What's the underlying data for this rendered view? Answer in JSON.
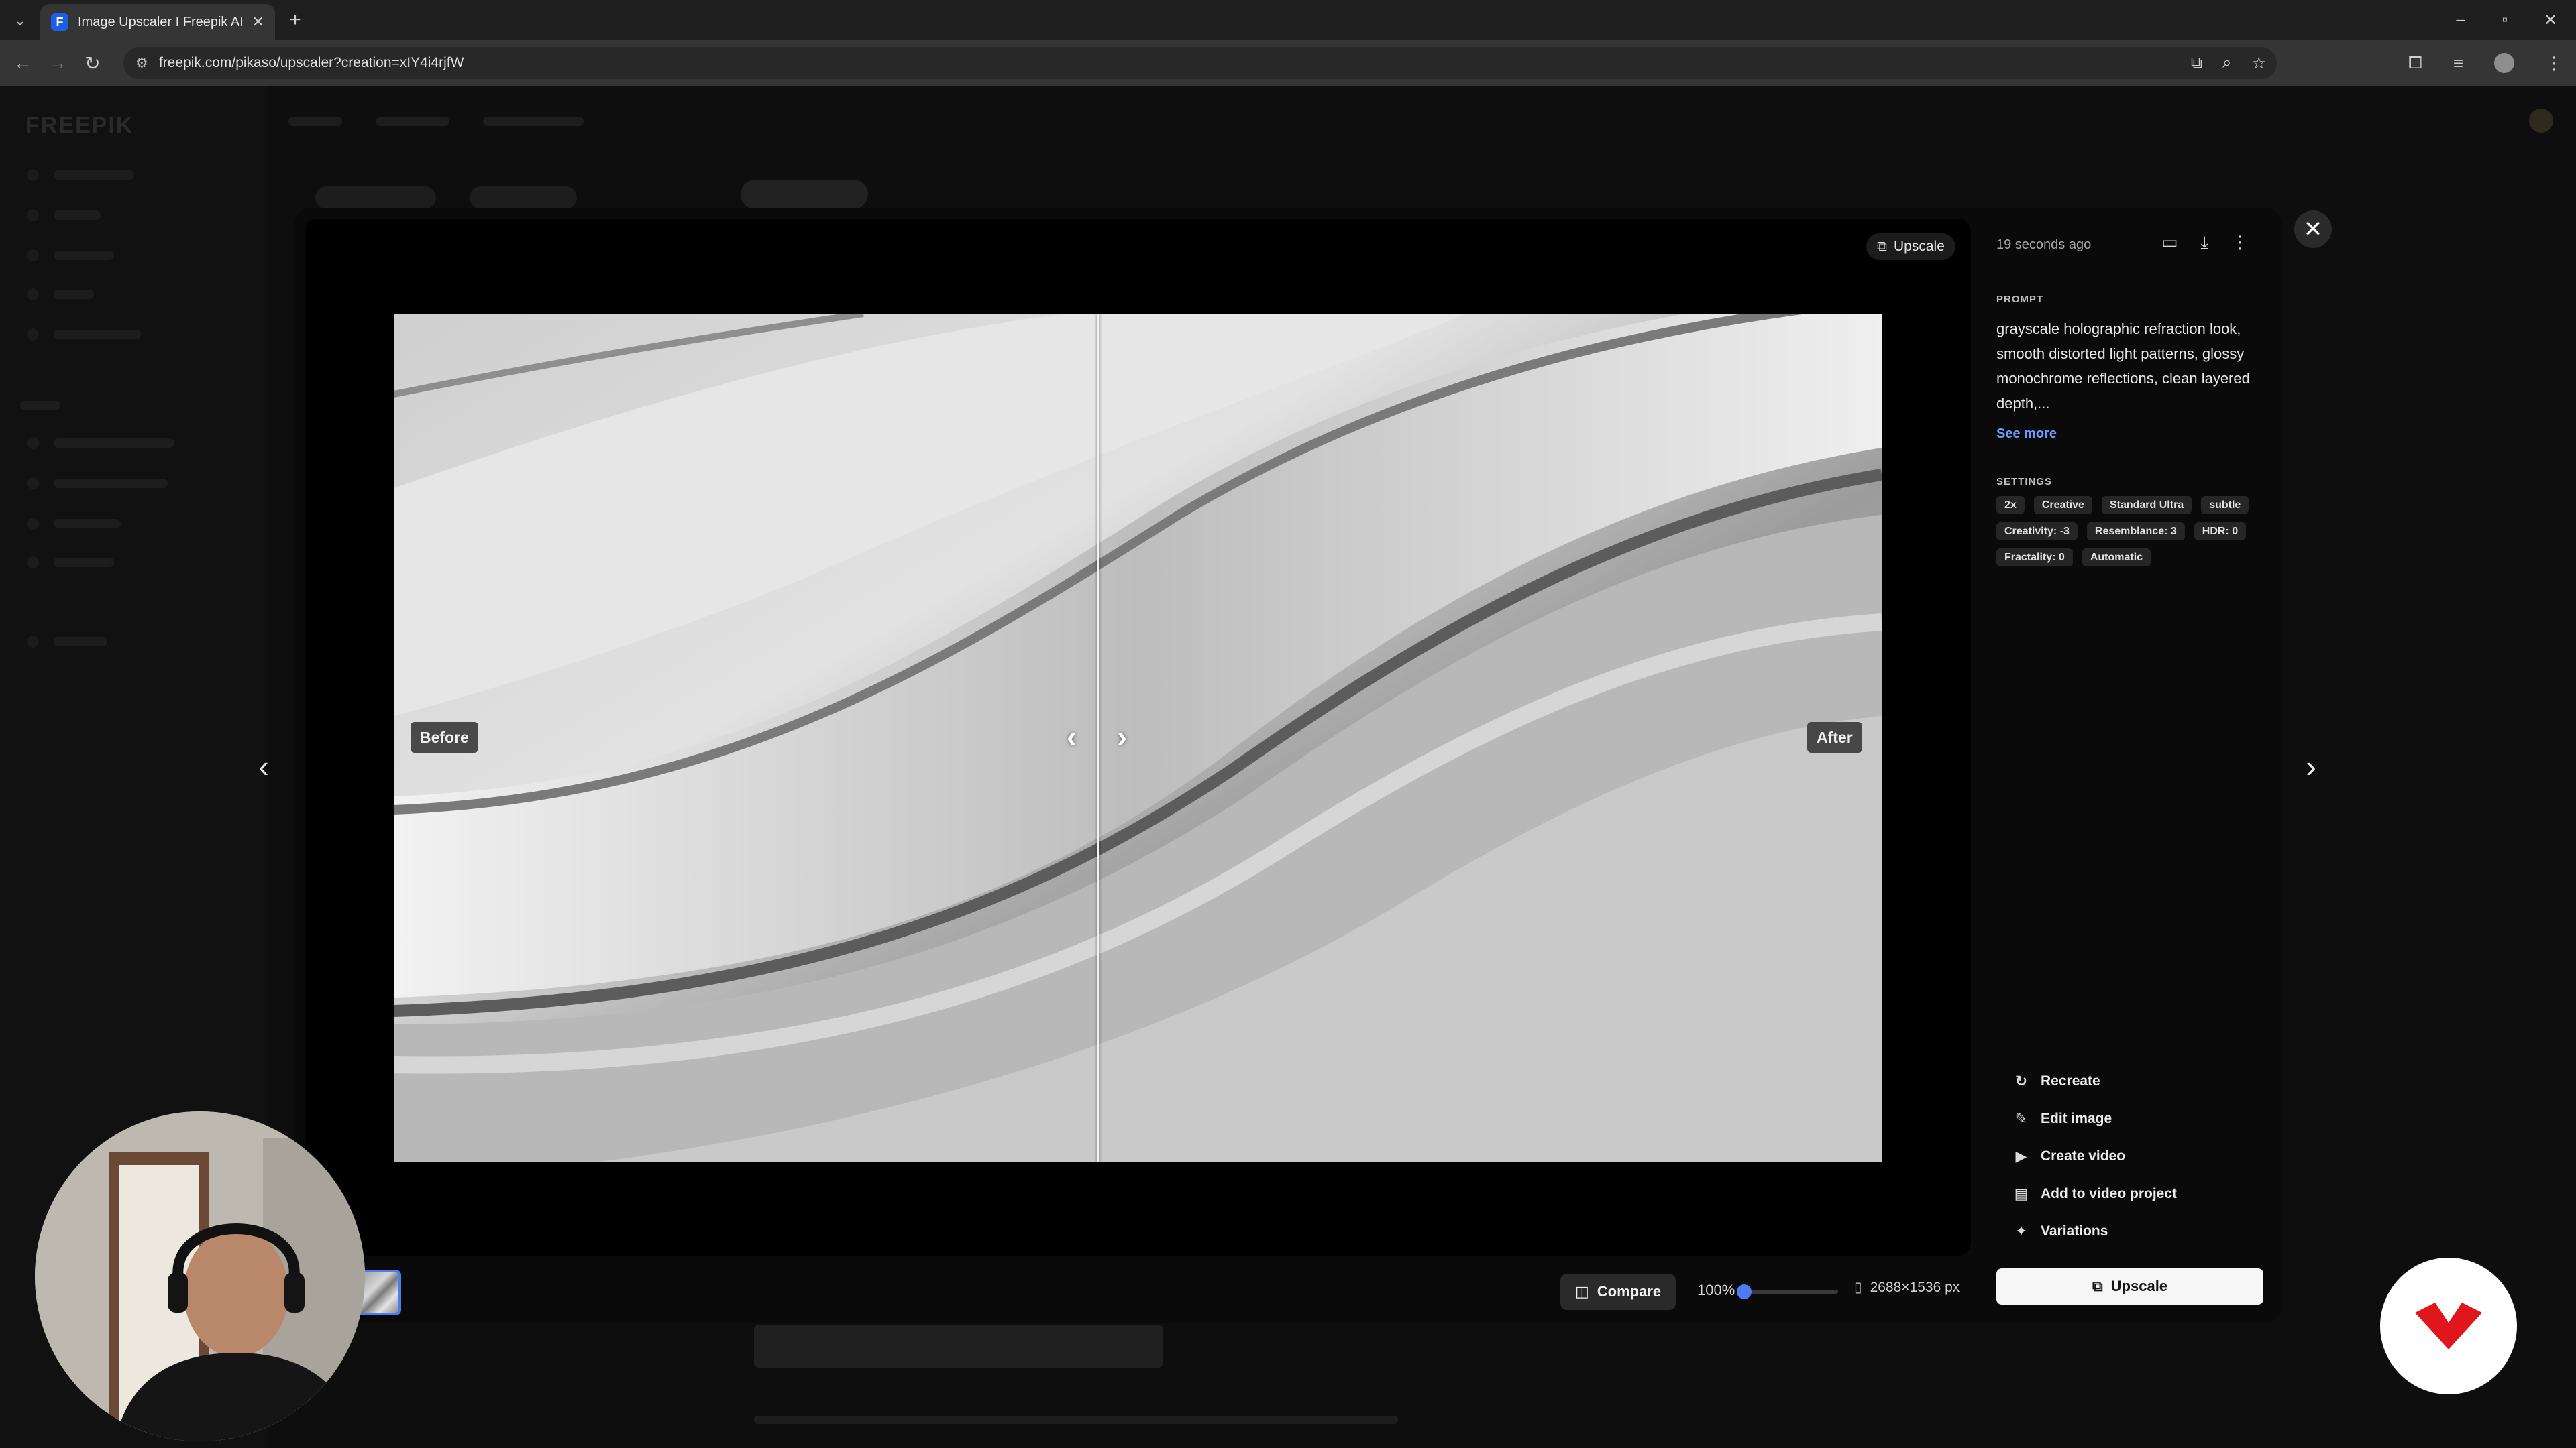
{
  "browser": {
    "tab_title": "Image Upscaler I Freepik AI",
    "tab_favicon": "F",
    "url": "freepik.com/pikaso/upscaler?creation=xIY4i4rjfW",
    "new_tab": "+",
    "window_controls": [
      "–",
      "▫",
      "✕"
    ]
  },
  "viewer": {
    "upscale_chip_label": "Upscale",
    "before_label": "Before",
    "after_label": "After",
    "image_colors": [
      "#8f8f8f",
      "#d9d9d9"
    ]
  },
  "bottom_bar": {
    "compare_label": "Compare",
    "zoom_label": "100%",
    "zoom_level": 0,
    "image_size": "2688×1536 px"
  },
  "panel": {
    "timestamp": "19 seconds ago",
    "prompt_title": "PROMPT",
    "prompt_text": "grayscale holographic refraction look, smooth distorted light patterns, glossy monochrome reflections, clean layered depth,...",
    "see_more": "See more",
    "settings_title": "SETTINGS",
    "settings": [
      "2x",
      "Creative",
      "Standard Ultra",
      "subtle",
      "Creativity: -3",
      "Resemblance: 3",
      "HDR: 0",
      "Fractality: 0",
      "Automatic"
    ],
    "actions": [
      {
        "label": "Recreate",
        "icon": "refresh-icon"
      },
      {
        "label": "Edit image",
        "icon": "edit-image-icon"
      },
      {
        "label": "Create video",
        "icon": "video-icon"
      },
      {
        "label": "Add to video project",
        "icon": "video-project-icon"
      },
      {
        "label": "Variations",
        "icon": "sparkle-icon"
      }
    ],
    "upscale_button": "Upscale"
  },
  "colors": {
    "accent": "#4b7cf2",
    "link": "#6e9bff",
    "brand_badge": "#e0161d"
  }
}
